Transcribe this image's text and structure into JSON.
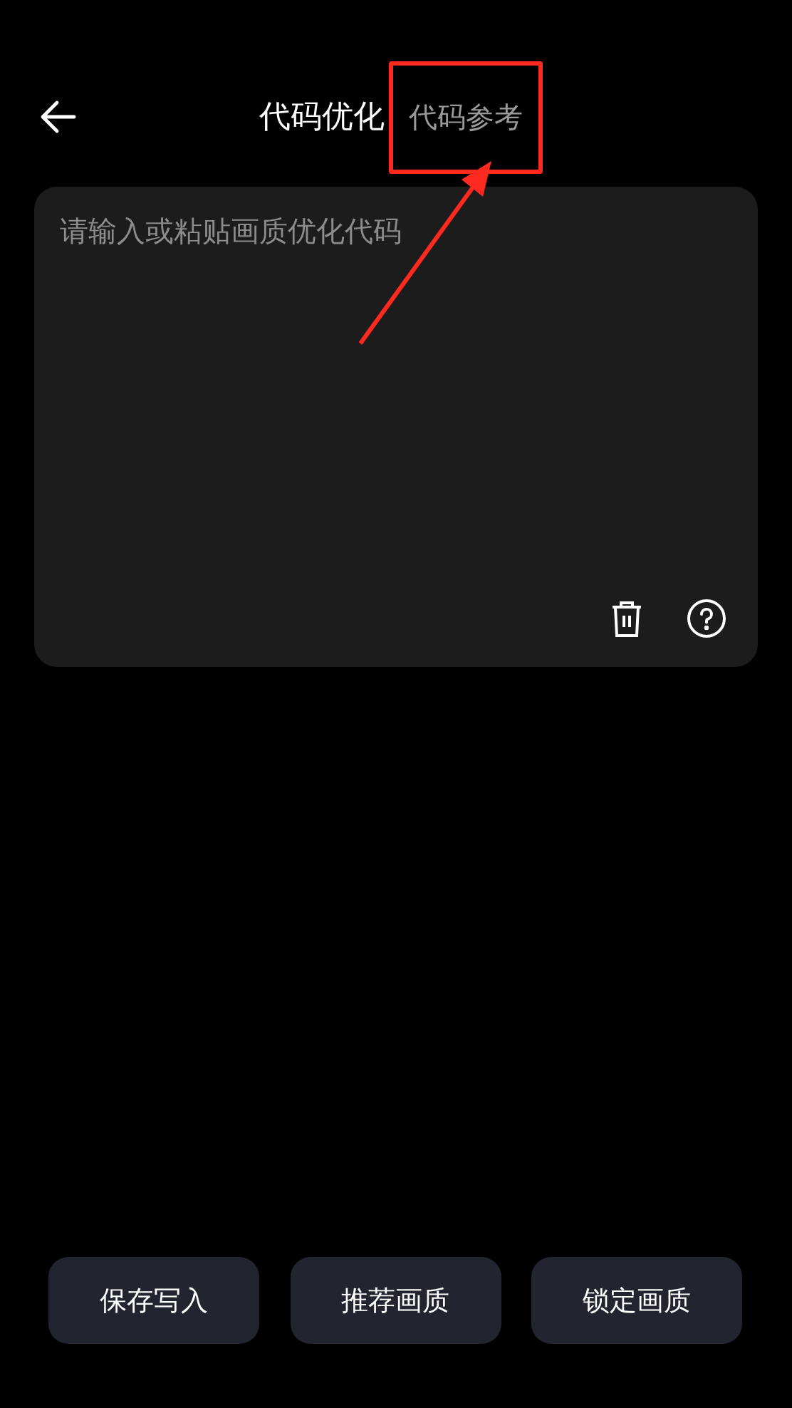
{
  "header": {
    "title": "代码优化",
    "link": "代码参考"
  },
  "editor": {
    "placeholder": "请输入或粘贴画质优化代码"
  },
  "buttons": [
    {
      "label": "保存写入"
    },
    {
      "label": "推荐画质"
    },
    {
      "label": "锁定画质"
    }
  ]
}
